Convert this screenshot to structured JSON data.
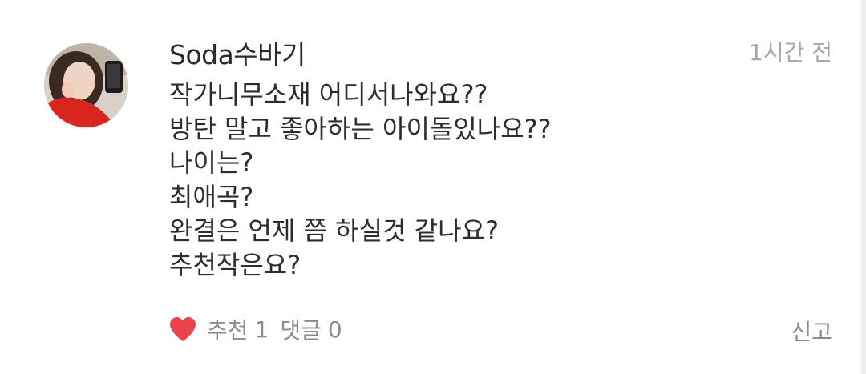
{
  "comment": {
    "username": "Soda수바기",
    "timestamp": "1시간 전",
    "lines": [
      "작가니무소재 어디서나와요??",
      "방탄 말고 좋아하는 아이돌있나요??",
      "나이는?",
      "최애곡?",
      "완결은 언제 쯤 하실것 같나요?",
      "추천작은요?"
    ],
    "actions": {
      "like_icon": "heart-icon",
      "like_label": "추천",
      "like_count": "1",
      "reply_label": "댓글",
      "reply_count": "0",
      "report_label": "신고"
    },
    "colors": {
      "heart": "#e8434a",
      "muted": "#8c8c8c",
      "timestamp": "#a7a7a7",
      "text": "#2d2d2d"
    }
  }
}
